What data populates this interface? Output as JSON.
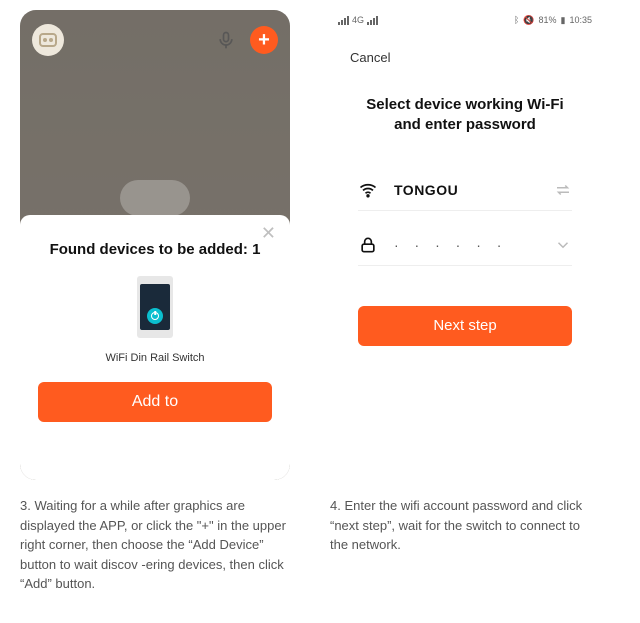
{
  "left": {
    "sheet": {
      "title": "Found devices to be added: 1",
      "device_name": "WiFi Din Rail Switch",
      "add_label": "Add to"
    }
  },
  "right": {
    "status": {
      "battery": "81%",
      "time": "10:35"
    },
    "cancel": "Cancel",
    "title": "Select device working Wi-Fi\nand enter password",
    "ssid": "TONGOU",
    "password_mask": "· · · · · ·",
    "next_label": "Next step"
  },
  "instructions": {
    "step3": "3. Waiting for a while after graphics are displayed the APP, or click the \"+\" in the upper right corner, then choose the “Add Device” button to wait discov -ering devices, then click “Add” button.",
    "step4": "4. Enter the wifi account password and click “next step”, wait for the switch to connect to the network."
  }
}
